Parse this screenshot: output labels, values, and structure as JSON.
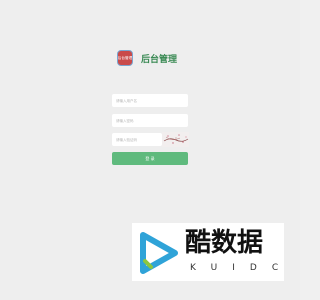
{
  "brand": {
    "logo_text": "后台管理",
    "title": "后台管理"
  },
  "form": {
    "username_placeholder": "请输入用户名",
    "password_placeholder": "请输入密码",
    "captcha_placeholder": "请输入验证码",
    "login_label": "登 录"
  },
  "watermark": {
    "text": "酷数据",
    "sub": "KUIDC"
  },
  "colors": {
    "accent": "#5fba7d",
    "brand_title": "#3a8a54",
    "logo_bg": "#c94a4a",
    "watermark_icon": "#2fa3d8"
  }
}
